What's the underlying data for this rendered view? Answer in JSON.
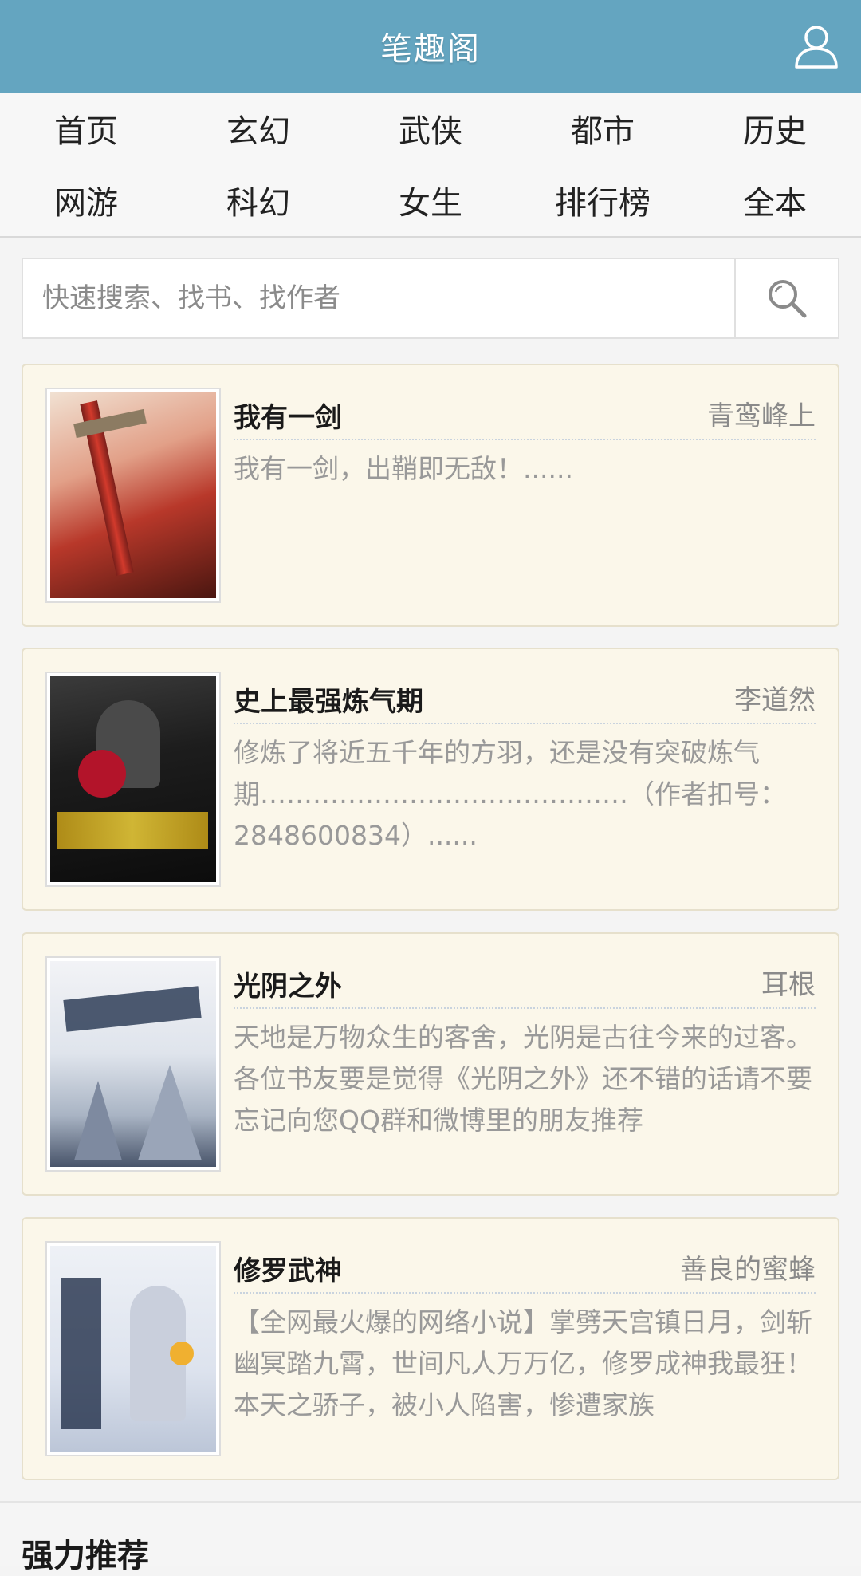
{
  "header": {
    "title": "笔趣阁",
    "user_icon": "user-icon"
  },
  "nav": {
    "items": [
      "首页",
      "玄幻",
      "武侠",
      "都市",
      "历史",
      "网游",
      "科幻",
      "女生",
      "排行榜",
      "全本"
    ]
  },
  "search": {
    "placeholder": "快速搜索、找书、找作者",
    "icon": "search-icon"
  },
  "books": [
    {
      "title": "我有一剑",
      "author": "青鸾峰上",
      "description": "我有一剑，出鞘即无敌！......"
    },
    {
      "title": "史上最强炼气期",
      "author": "李道然",
      "description": "修炼了将近五千年的方羽，还是没有突破炼气期……………………………………（作者扣号：2848600834）......"
    },
    {
      "title": "光阴之外",
      "author": "耳根",
      "description": "天地是万物众生的客舍，光阴是古往今来的过客。各位书友要是觉得《光阴之外》还不错的话请不要忘记向您QQ群和微博里的朋友推荐"
    },
    {
      "title": "修罗武神",
      "author": "善良的蜜蜂",
      "description": "【全网最火爆的网络小说】掌劈天宫镇日月，剑斩幽冥踏九霄，世间凡人万万亿，修罗成神我最狂！本天之骄子，被小人陷害，惨遭家族"
    }
  ],
  "section": {
    "title": "强力推荐"
  },
  "colors": {
    "header_bg": "#64a5c0",
    "card_bg": "#fbf7ea"
  }
}
